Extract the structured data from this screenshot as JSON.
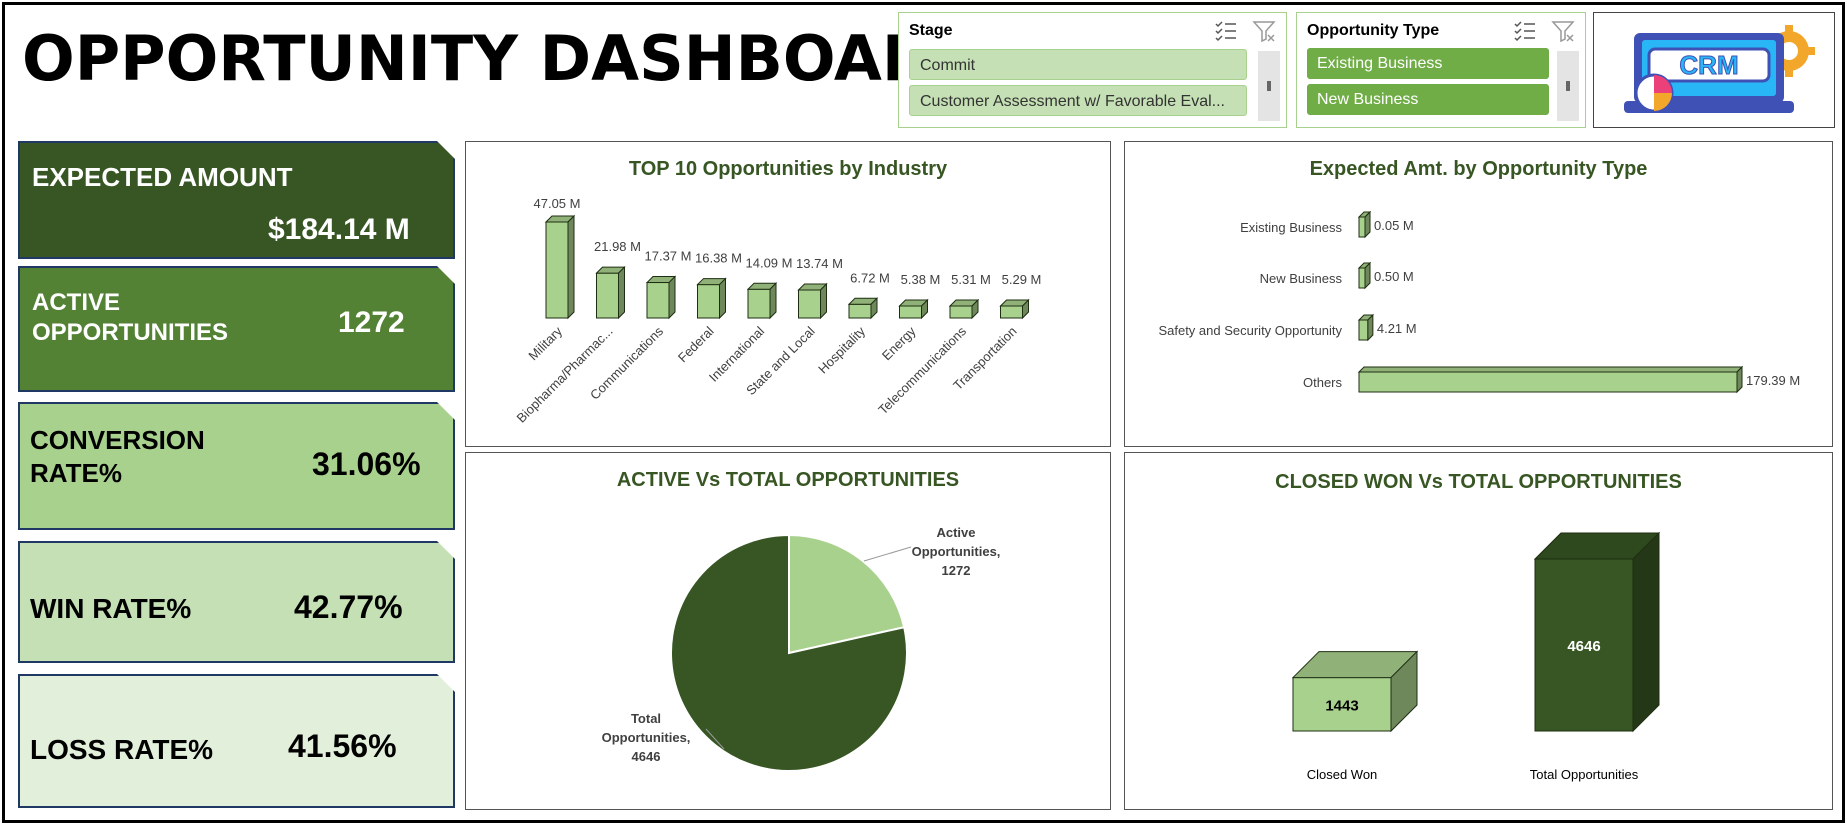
{
  "dashboard": {
    "title": "OPPORTUNITY DASHBOARD"
  },
  "slicers": {
    "stage": {
      "header": "Stage",
      "items": [
        "Commit",
        "Customer Assessment w/ Favorable Eval..."
      ]
    },
    "opportunity_type": {
      "header": "Opportunity Type",
      "items": [
        "Existing Business",
        "New Business"
      ]
    }
  },
  "logo": {
    "text": "CRM"
  },
  "kpis": [
    {
      "label": "EXPECTED AMOUNT",
      "value": "$184.14 M",
      "bg": "#375623",
      "fg": "#ffffff"
    },
    {
      "label": "ACTIVE\nOPPORTUNITIES",
      "value": "1272",
      "bg": "#548235",
      "fg": "#ffffff"
    },
    {
      "label": "CONVERSION\n RATE%",
      "value": "31.06%",
      "bg": "#a9d18e",
      "fg": "#000000"
    },
    {
      "label": "WIN RATE%",
      "value": "42.77%",
      "bg": "#c5e0b4",
      "fg": "#000000"
    },
    {
      "label": "LOSS RATE%",
      "value": "41.56%",
      "bg": "#e2efda",
      "fg": "#000000"
    }
  ],
  "chart_data": [
    {
      "type": "bar",
      "title": "TOP 10 Opportunities by Industry",
      "categories": [
        "Military",
        "Biopharma/Pharmac...",
        "Communications",
        "Federal",
        "International",
        "State and Local",
        "Hospitality",
        "Energy",
        "Telecommunications",
        "Transportation"
      ],
      "values": [
        47.05,
        21.98,
        17.37,
        16.38,
        14.09,
        13.74,
        6.72,
        5.38,
        5.31,
        5.29
      ],
      "data_labels": [
        "47.05 M",
        "21.98 M",
        "17.37 M",
        "16.38 M",
        "14.09 M",
        "13.74 M",
        "6.72 M",
        "5.38 M",
        "5.31 M",
        "5.29 M"
      ],
      "color": "#a9d18e"
    },
    {
      "type": "bar",
      "orientation": "horizontal",
      "title": "Expected Amt. by Opportunity Type",
      "categories": [
        "Existing Business",
        "New Business",
        "Safety and Security Opportunity",
        "Others"
      ],
      "values": [
        0.05,
        0.5,
        4.21,
        179.39
      ],
      "data_labels": [
        "0.05 M",
        "0.50 M",
        "4.21 M",
        "179.39 M"
      ],
      "color": "#a9d18e"
    },
    {
      "type": "pie",
      "title": "ACTIVE Vs TOTAL OPPORTUNITIES",
      "categories": [
        "Active Opportunities",
        "Total Opportunities"
      ],
      "values": [
        1272,
        4646
      ],
      "data_labels": [
        [
          "Active",
          "Opportunities,",
          "1272"
        ],
        [
          "Total",
          "Opportunities,",
          "4646"
        ]
      ],
      "colors": [
        "#a9d18e",
        "#375623"
      ]
    },
    {
      "type": "bar",
      "title": "CLOSED WON Vs TOTAL OPPORTUNITIES",
      "categories": [
        "Closed Won",
        "Total Opportunities"
      ],
      "values": [
        1443,
        4646
      ],
      "data_labels": [
        "1443",
        "4646"
      ],
      "colors": [
        "#a9d18e",
        "#375623"
      ]
    }
  ]
}
